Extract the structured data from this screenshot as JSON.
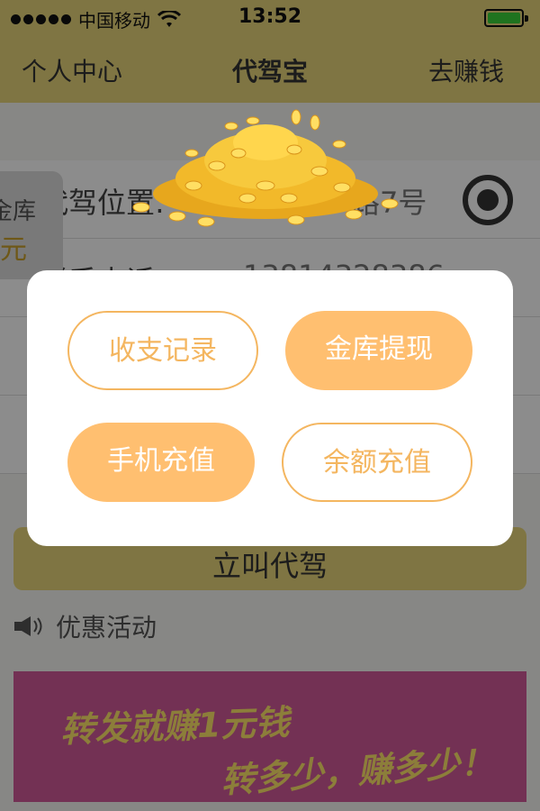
{
  "status_bar": {
    "carrier": "中国移动",
    "time": "13:52"
  },
  "nav": {
    "left": "个人中心",
    "title": "代驾宝",
    "right": "去赚钱"
  },
  "rows": [
    {
      "label": "代驾位置:",
      "value": "路7号"
    },
    {
      "label": "联系电话",
      "value": "13814328386"
    }
  ],
  "vault_tab": {
    "line1": "金库",
    "line2": "元"
  },
  "call_button": {
    "label": "立叫代驾"
  },
  "promo": {
    "title": "优惠活动"
  },
  "banner": {
    "line1": "转发就赚1元钱",
    "line2": "转多少，赚多少！"
  },
  "modal": {
    "buttons": [
      {
        "label": "收支记录"
      },
      {
        "label": "金库提现"
      },
      {
        "label": "手机充值"
      },
      {
        "label": "余额充值"
      }
    ]
  },
  "colors": {
    "accent": "#e8d67a",
    "button_orange": "#ffbf70",
    "outline_orange": "#f4b660",
    "banner": "#d15a9a"
  }
}
